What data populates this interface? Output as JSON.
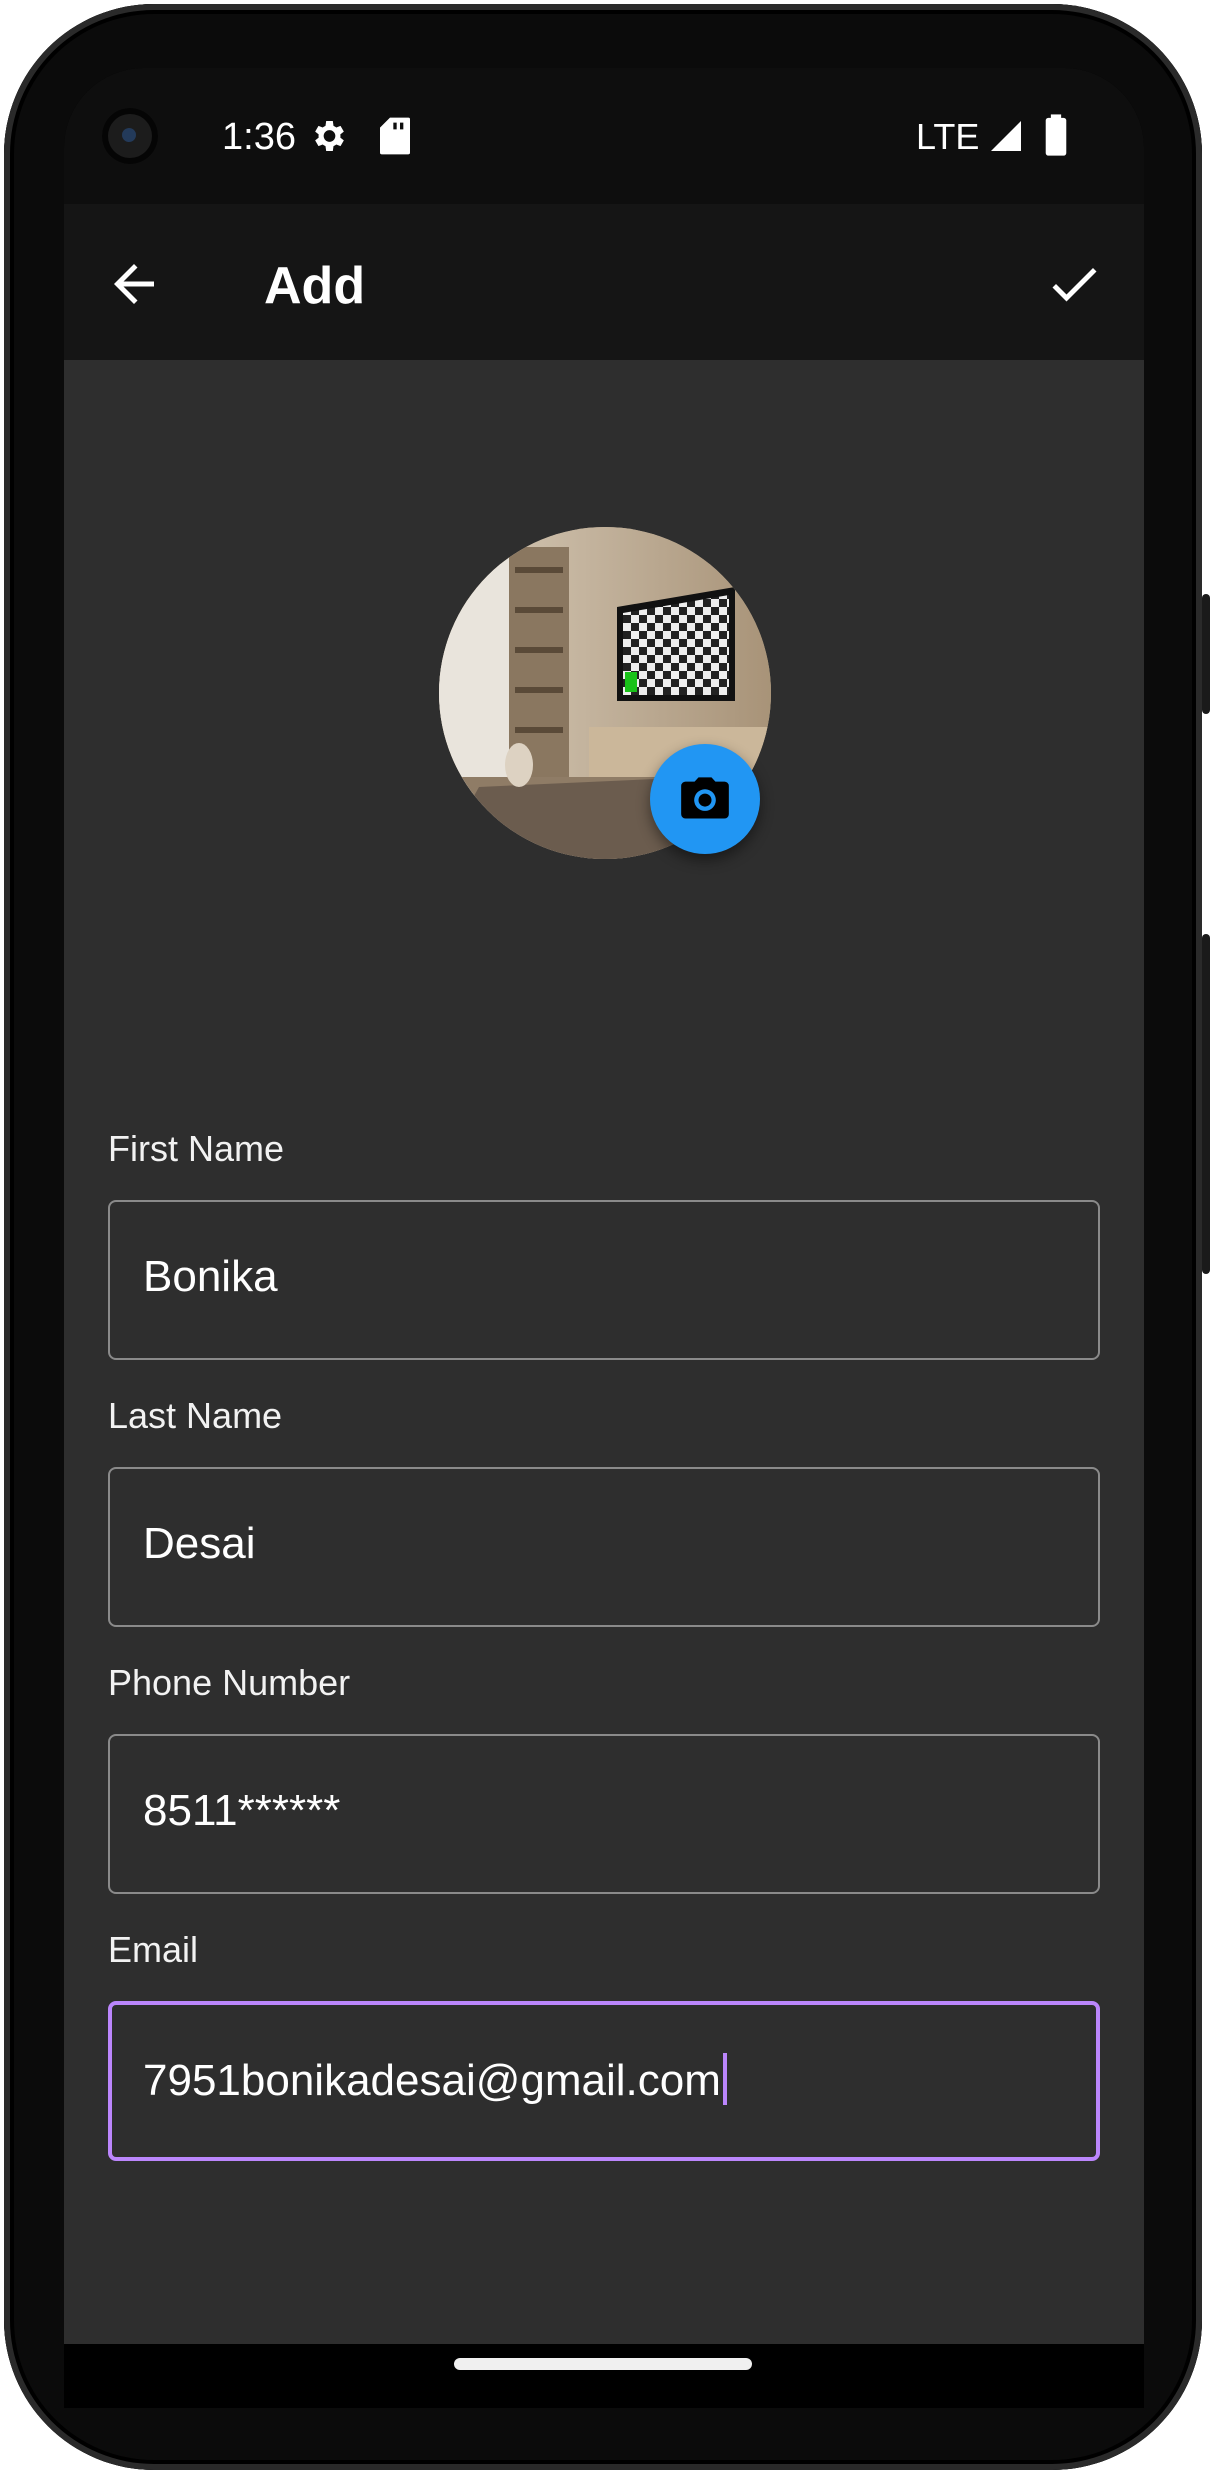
{
  "status_bar": {
    "time": "1:36",
    "network": "LTE",
    "icons": [
      "settings-gear-icon",
      "sd-card-icon",
      "signal-icon",
      "battery-icon"
    ]
  },
  "app_bar": {
    "title": "Add",
    "back_icon": "arrow-back-icon",
    "save_icon": "check-icon"
  },
  "avatar": {
    "image": "living-room-with-tv-photo",
    "change_photo_icon": "camera-icon",
    "fab_color": "#2196f3"
  },
  "form": {
    "fields": [
      {
        "label": "First Name",
        "value": "Bonika"
      },
      {
        "label": "Last Name",
        "value": "Desai"
      },
      {
        "label": "Phone Number",
        "value": "8511******"
      },
      {
        "label": "Email",
        "value": "7951bonikadesai@gmail.com",
        "focused": true
      }
    ]
  },
  "colors": {
    "background": "#2e2e2e",
    "app_bar": "#151515",
    "focus_accent": "#bb86fc",
    "field_border": "#8a8a8a"
  }
}
